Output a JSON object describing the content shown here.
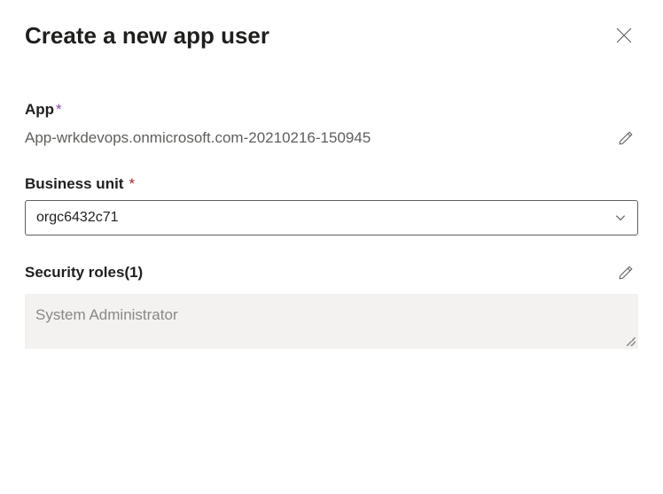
{
  "header": {
    "title": "Create a new app user"
  },
  "app": {
    "label": "App",
    "value": "App-wrkdevops.onmicrosoft.com-20210216-150945"
  },
  "businessUnit": {
    "label": "Business unit",
    "selected": "orgc6432c71"
  },
  "securityRoles": {
    "label": "Security roles(1)",
    "items": [
      "System Administrator"
    ]
  }
}
